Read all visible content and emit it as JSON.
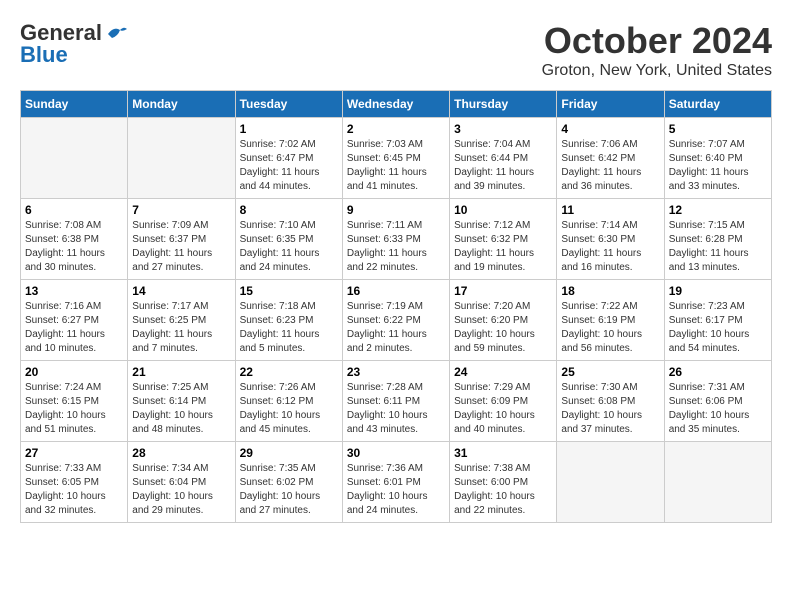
{
  "header": {
    "logo_general": "General",
    "logo_blue": "Blue",
    "month": "October 2024",
    "location": "Groton, New York, United States"
  },
  "weekdays": [
    "Sunday",
    "Monday",
    "Tuesday",
    "Wednesday",
    "Thursday",
    "Friday",
    "Saturday"
  ],
  "weeks": [
    [
      {
        "day": "",
        "info": ""
      },
      {
        "day": "",
        "info": ""
      },
      {
        "day": "1",
        "info": "Sunrise: 7:02 AM\nSunset: 6:47 PM\nDaylight: 11 hours and 44 minutes."
      },
      {
        "day": "2",
        "info": "Sunrise: 7:03 AM\nSunset: 6:45 PM\nDaylight: 11 hours and 41 minutes."
      },
      {
        "day": "3",
        "info": "Sunrise: 7:04 AM\nSunset: 6:44 PM\nDaylight: 11 hours and 39 minutes."
      },
      {
        "day": "4",
        "info": "Sunrise: 7:06 AM\nSunset: 6:42 PM\nDaylight: 11 hours and 36 minutes."
      },
      {
        "day": "5",
        "info": "Sunrise: 7:07 AM\nSunset: 6:40 PM\nDaylight: 11 hours and 33 minutes."
      }
    ],
    [
      {
        "day": "6",
        "info": "Sunrise: 7:08 AM\nSunset: 6:38 PM\nDaylight: 11 hours and 30 minutes."
      },
      {
        "day": "7",
        "info": "Sunrise: 7:09 AM\nSunset: 6:37 PM\nDaylight: 11 hours and 27 minutes."
      },
      {
        "day": "8",
        "info": "Sunrise: 7:10 AM\nSunset: 6:35 PM\nDaylight: 11 hours and 24 minutes."
      },
      {
        "day": "9",
        "info": "Sunrise: 7:11 AM\nSunset: 6:33 PM\nDaylight: 11 hours and 22 minutes."
      },
      {
        "day": "10",
        "info": "Sunrise: 7:12 AM\nSunset: 6:32 PM\nDaylight: 11 hours and 19 minutes."
      },
      {
        "day": "11",
        "info": "Sunrise: 7:14 AM\nSunset: 6:30 PM\nDaylight: 11 hours and 16 minutes."
      },
      {
        "day": "12",
        "info": "Sunrise: 7:15 AM\nSunset: 6:28 PM\nDaylight: 11 hours and 13 minutes."
      }
    ],
    [
      {
        "day": "13",
        "info": "Sunrise: 7:16 AM\nSunset: 6:27 PM\nDaylight: 11 hours and 10 minutes."
      },
      {
        "day": "14",
        "info": "Sunrise: 7:17 AM\nSunset: 6:25 PM\nDaylight: 11 hours and 7 minutes."
      },
      {
        "day": "15",
        "info": "Sunrise: 7:18 AM\nSunset: 6:23 PM\nDaylight: 11 hours and 5 minutes."
      },
      {
        "day": "16",
        "info": "Sunrise: 7:19 AM\nSunset: 6:22 PM\nDaylight: 11 hours and 2 minutes."
      },
      {
        "day": "17",
        "info": "Sunrise: 7:20 AM\nSunset: 6:20 PM\nDaylight: 10 hours and 59 minutes."
      },
      {
        "day": "18",
        "info": "Sunrise: 7:22 AM\nSunset: 6:19 PM\nDaylight: 10 hours and 56 minutes."
      },
      {
        "day": "19",
        "info": "Sunrise: 7:23 AM\nSunset: 6:17 PM\nDaylight: 10 hours and 54 minutes."
      }
    ],
    [
      {
        "day": "20",
        "info": "Sunrise: 7:24 AM\nSunset: 6:15 PM\nDaylight: 10 hours and 51 minutes."
      },
      {
        "day": "21",
        "info": "Sunrise: 7:25 AM\nSunset: 6:14 PM\nDaylight: 10 hours and 48 minutes."
      },
      {
        "day": "22",
        "info": "Sunrise: 7:26 AM\nSunset: 6:12 PM\nDaylight: 10 hours and 45 minutes."
      },
      {
        "day": "23",
        "info": "Sunrise: 7:28 AM\nSunset: 6:11 PM\nDaylight: 10 hours and 43 minutes."
      },
      {
        "day": "24",
        "info": "Sunrise: 7:29 AM\nSunset: 6:09 PM\nDaylight: 10 hours and 40 minutes."
      },
      {
        "day": "25",
        "info": "Sunrise: 7:30 AM\nSunset: 6:08 PM\nDaylight: 10 hours and 37 minutes."
      },
      {
        "day": "26",
        "info": "Sunrise: 7:31 AM\nSunset: 6:06 PM\nDaylight: 10 hours and 35 minutes."
      }
    ],
    [
      {
        "day": "27",
        "info": "Sunrise: 7:33 AM\nSunset: 6:05 PM\nDaylight: 10 hours and 32 minutes."
      },
      {
        "day": "28",
        "info": "Sunrise: 7:34 AM\nSunset: 6:04 PM\nDaylight: 10 hours and 29 minutes."
      },
      {
        "day": "29",
        "info": "Sunrise: 7:35 AM\nSunset: 6:02 PM\nDaylight: 10 hours and 27 minutes."
      },
      {
        "day": "30",
        "info": "Sunrise: 7:36 AM\nSunset: 6:01 PM\nDaylight: 10 hours and 24 minutes."
      },
      {
        "day": "31",
        "info": "Sunrise: 7:38 AM\nSunset: 6:00 PM\nDaylight: 10 hours and 22 minutes."
      },
      {
        "day": "",
        "info": ""
      },
      {
        "day": "",
        "info": ""
      }
    ]
  ]
}
